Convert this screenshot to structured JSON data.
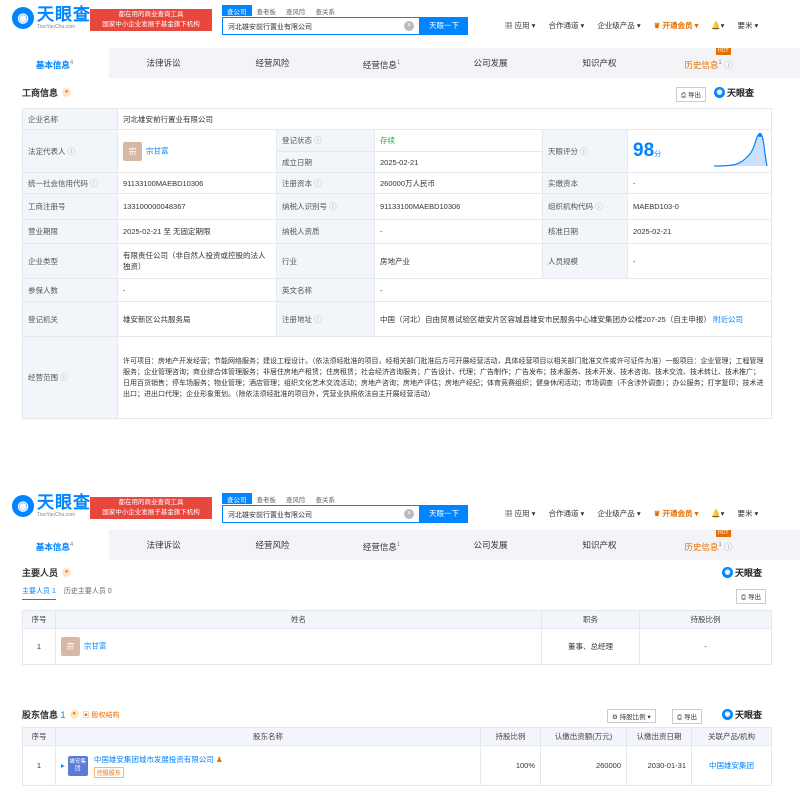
{
  "header": {
    "logo_text": "天眼查",
    "logo_sub": "TianYanCha.com",
    "promo_line1": "都在用的商业查询工具",
    "promo_line2": "国家中小企业发展子基金旗下机构",
    "search_tabs": [
      "查公司",
      "查老板",
      "查风险",
      "查关系"
    ],
    "search_value": "河北雄安前行置业有限公司",
    "search_clear": "×",
    "search_button": "天眼一下",
    "nav": [
      "应用",
      "合作通道",
      "企业级产品",
      "开通会员",
      "",
      "要米"
    ]
  },
  "tabs": [
    {
      "label": "基本信息",
      "count": "4"
    },
    {
      "label": "法律诉讼",
      "count": ""
    },
    {
      "label": "经营风险",
      "count": ""
    },
    {
      "label": "经营信息",
      "count": "1"
    },
    {
      "label": "公司发展",
      "count": ""
    },
    {
      "label": "知识产权",
      "count": ""
    },
    {
      "label": "历史信息",
      "count": "1"
    }
  ],
  "hot_badge": "HOT",
  "s1": {
    "section_title": "工商信息",
    "export": "导出",
    "brand": "天眼查",
    "rows": {
      "name_label": "企业名称",
      "name_value": "河北雄安前行置业有限公司",
      "legal_label": "法定代表人",
      "legal_avatar": "宗",
      "legal_value": "宗甘富",
      "status_label": "登记状态",
      "status_value": "存续",
      "date_label": "成立日期",
      "date_value": "2025-02-21",
      "score_label": "天眼评分",
      "score_value": "98",
      "score_unit": "分",
      "credit_label": "统一社会信用代码",
      "credit_value": "91133100MAEBD10306",
      "capital_label": "注册资本",
      "capital_value": "260000万人民币",
      "paid_label": "实缴资本",
      "paid_value": "-",
      "reg_label": "工商注册号",
      "reg_value": "133100000048367",
      "tax_label": "纳税人识别号",
      "tax_value": "91133100MAEBD10306",
      "org_label": "组织机构代码",
      "org_value": "MAEBD103-0",
      "term_label": "营业期限",
      "term_value": "2025-02-21 至 无固定期限",
      "taxq_label": "纳税人资质",
      "taxq_value": "-",
      "approve_label": "核准日期",
      "approve_value": "2025-02-21",
      "type_label": "企业类型",
      "type_value": "有限责任公司（非自然人投资或控股的法人独资）",
      "industry_label": "行业",
      "industry_value": "房地产业",
      "staff_label": "人员规模",
      "staff_value": "-",
      "insured_label": "参保人数",
      "insured_value": "-",
      "en_label": "英文名称",
      "en_value": "-",
      "authority_label": "登记机关",
      "authority_value": "雄安新区公共服务局",
      "addr_label": "注册地址",
      "addr_value": "中国（河北）自由贸易试验区雄安片区容城县雄安市民服务中心雄安集团办公楼207-25（自主申报）",
      "addr_link": "附近公司",
      "scope_label": "经营范围",
      "scope_value": "许可项目：房地产开发经营；节能网络服务；建设工程设计。（依法须经批准的项目，经相关部门批准后方可开展经营活动，具体经营项目以相关部门批准文件或许可证件为准）一般项目：企业管理；工程管理服务；企业管理咨询；商业综合体管理服务；非居住房地产租赁；住房租赁；社会经济咨询服务；广告设计、代理；广告制作；广告发布；技术服务、技术开发、技术咨询、技术交流、技术转让、技术推广；日用百货销售；停车场服务；物业管理；酒店管理；组织文化艺术交流活动；房地产咨询；房地产评估；房地产经纪；体育竞赛组织；健身休闲活动；市场调查（不含涉外调查）；办公服务；打字复印；技术进出口；进出口代理；企业形象策划。（除依法须经批准的项目外，凭营业执照依法自主开展经营活动）"
    }
  },
  "s2": {
    "section_title": "主要人员",
    "brand": "天眼查",
    "sub_tabs": [
      "主要人员 1",
      "历史主要人员 0"
    ],
    "export": "导出",
    "cols": [
      "序号",
      "姓名",
      "职务",
      "持股比例"
    ],
    "rows": [
      {
        "idx": "1",
        "avatar": "宗",
        "name": "宗甘富",
        "role": "董事、总经理",
        "share": "-"
      }
    ]
  },
  "s3": {
    "section_title": "股东信息",
    "count": "1",
    "equity_btn": "股权结构",
    "filter_btn": "持股比例",
    "export": "导出",
    "brand": "天眼查",
    "cols": [
      "序号",
      "股东名称",
      "持股比例",
      "认缴出资额(万元)",
      "认缴出资日期",
      "关联产品/机构"
    ],
    "rows": [
      {
        "idx": "1",
        "avatar": "雄安集团",
        "name": "中国雄安集团城市发展投资有限公司",
        "tag": "控股股东",
        "share": "100%",
        "amount": "260000",
        "date": "2030-01-31",
        "org": "中国雄安集团"
      }
    ]
  }
}
